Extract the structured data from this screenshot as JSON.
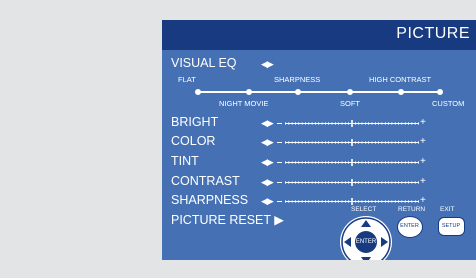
{
  "menu": {
    "title": "PICTURE"
  },
  "visual_eq": {
    "label": "VISUAL EQ",
    "arrows": "◀▶",
    "modes_top": [
      "FLAT",
      "SHARPNESS",
      "HIGH CONTRAST"
    ],
    "modes_bottom": [
      "NIGHT MOVIE",
      "SOFT",
      "CUSTOM"
    ]
  },
  "sliders": [
    {
      "label": "BRIGHT",
      "level": 0.5
    },
    {
      "label": "COLOR",
      "level": 0.5
    },
    {
      "label": "TINT",
      "level": 0.5
    },
    {
      "label": "CONTRAST",
      "level": 0.5
    },
    {
      "label": "SHARPNESS",
      "level": 0.5
    }
  ],
  "slider_controls": {
    "arrows": "◀▶",
    "minus": "−",
    "plus": "+"
  },
  "picture_reset": {
    "label": "PICTURE RESET ▶"
  },
  "remote": {
    "select_label": "SELECT",
    "return_label": "RETURN",
    "exit_label": "EXIT",
    "enter_button": "ENTER",
    "return_button": "ENTER",
    "setup_button": "SETUP"
  },
  "colors": {
    "panel": "#4571b4",
    "header": "#173a80",
    "background": "#e3e4e5"
  }
}
